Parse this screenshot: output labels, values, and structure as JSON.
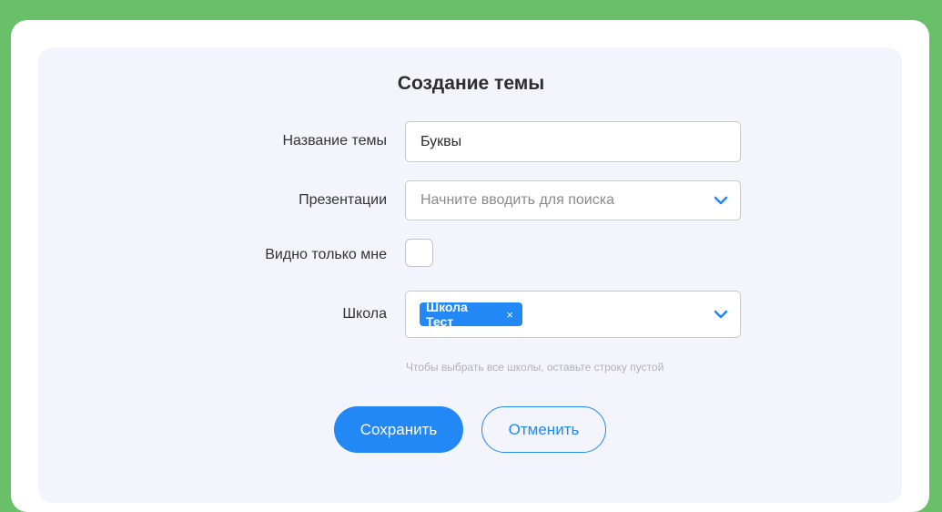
{
  "form": {
    "title": "Создание темы",
    "topic_name": {
      "label": "Название темы",
      "value": "Буквы"
    },
    "presentations": {
      "label": "Презентации",
      "placeholder": "Начните вводить для поиска"
    },
    "only_me": {
      "label": "Видно только мне",
      "checked": false
    },
    "school": {
      "label": "Школа",
      "selected_tag": "Школа Тест",
      "remove_glyph": "×",
      "hint": "Чтобы выбрать все школы, оставьте строку пустой"
    },
    "save_label": "Сохранить",
    "cancel_label": "Отменить"
  },
  "colors": {
    "background": "#6abf69",
    "accent": "#2188f6",
    "panel": "#f4f4fc"
  },
  "icons": [
    "chevron-down-icon",
    "close-icon"
  ]
}
